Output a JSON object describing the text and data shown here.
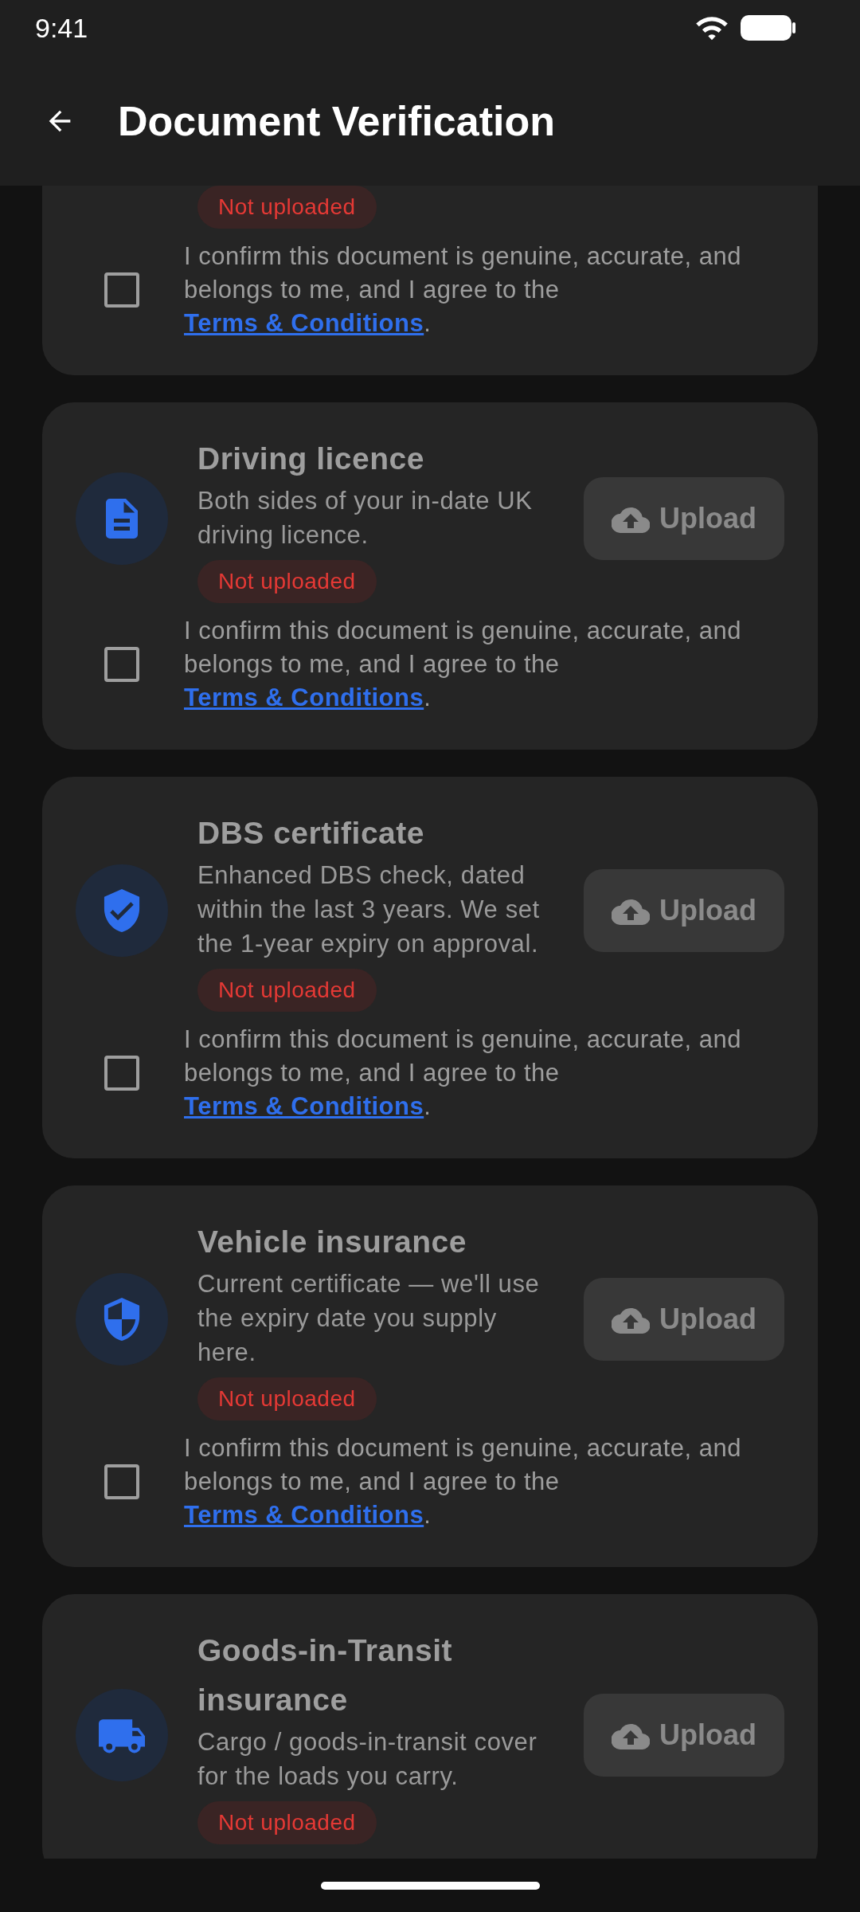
{
  "status_bar": {
    "time": "9:41"
  },
  "app_bar": {
    "title": "Document Verification"
  },
  "documents": [
    {
      "status": {
        "label": "Not uploaded",
        "kind": "missing"
      },
      "consent": {
        "text": "I confirm this document is genuine, accurate, and belongs to me, and I agree to the ",
        "link": "Terms & Conditions",
        "after": ".",
        "checked": false
      }
    },
    {
      "kind": "document",
      "title": "Driving licence",
      "description": "Both sides of your in-date UK driving licence.",
      "upload": {
        "label": "Upload",
        "disabled": true
      },
      "status": {
        "label": "Not uploaded",
        "kind": "missing"
      },
      "consent": {
        "text": "I confirm this document is genuine, accurate, and belongs to me, and I agree to the ",
        "link": "Terms & Conditions",
        "after": ".",
        "checked": false
      }
    },
    {
      "kind": "shield-check",
      "title": "DBS certificate",
      "description": "Enhanced DBS check, dated within the last 3 years. We set the 1-year expiry on approval.",
      "upload": {
        "label": "Upload",
        "disabled": true
      },
      "status": {
        "label": "Not uploaded",
        "kind": "missing"
      },
      "consent": {
        "text": "I confirm this document is genuine, accurate, and belongs to me, and I agree to the ",
        "link": "Terms & Conditions",
        "after": ".",
        "checked": false
      }
    },
    {
      "kind": "shield",
      "title": "Vehicle insurance",
      "description": "Current certificate — we'll use the expiry date you supply here.",
      "upload": {
        "label": "Upload",
        "disabled": true
      },
      "status": {
        "label": "Not uploaded",
        "kind": "missing"
      },
      "consent": {
        "text": "I confirm this document is genuine, accurate, and belongs to me, and I agree to the ",
        "link": "Terms & Conditions",
        "after": ".",
        "checked": false
      }
    },
    {
      "kind": "truck",
      "title": "Goods-in-Transit insurance",
      "description": "Cargo / goods-in-transit cover for the loads you carry.",
      "upload": {
        "label": "Upload",
        "disabled": true
      },
      "status": {
        "label": "Not uploaded",
        "kind": "missing"
      }
    }
  ]
}
